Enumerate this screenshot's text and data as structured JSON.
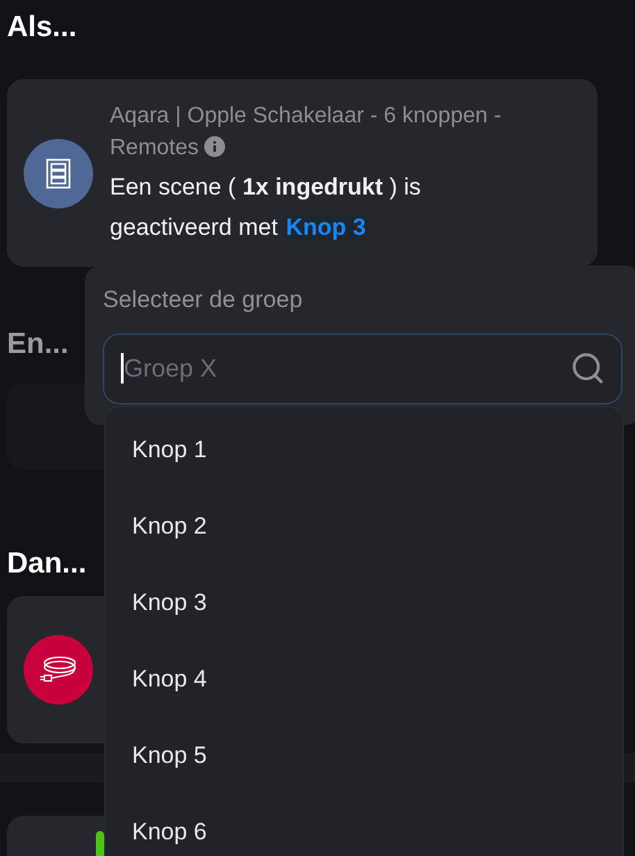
{
  "trigger": {
    "heading": "Als...",
    "device": "Aqara | Opple Schakelaar - 6 knoppen - Remotes",
    "sentence": "Een scene ( **1x ingedrukt** ) is geactiveerd met",
    "link": "Knop 3"
  },
  "conditions": {
    "heading": "En..."
  },
  "actions": {
    "heading": "Dan..."
  },
  "group_picker": {
    "label": "Selecteer de groep",
    "search": {
      "placeholder": "Groep X"
    },
    "options": [
      {
        "label": "Knop 1"
      },
      {
        "label": "Knop 2"
      },
      {
        "label": "Knop 3"
      },
      {
        "label": "Knop 4"
      },
      {
        "label": "Knop 5"
      },
      {
        "label": "Knop 6"
      }
    ]
  }
}
